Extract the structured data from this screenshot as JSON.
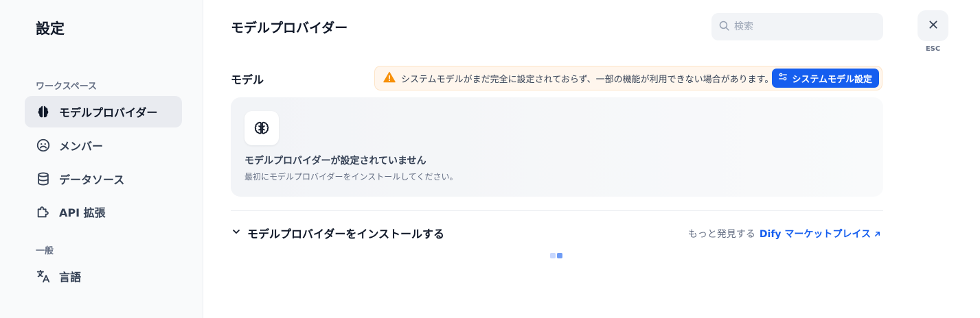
{
  "sidebar": {
    "title": "設定",
    "workspace_label": "ワークスペース",
    "general_label": "一般",
    "items": [
      {
        "label": "モデルプロバイダー",
        "icon": "brain-icon",
        "active": true
      },
      {
        "label": "メンバー",
        "icon": "members-icon",
        "active": false
      },
      {
        "label": "データソース",
        "icon": "database-icon",
        "active": false
      },
      {
        "label": "API 拡張",
        "icon": "puzzle-icon",
        "active": false
      },
      {
        "label": "言語",
        "icon": "translate-icon",
        "active": false
      }
    ]
  },
  "header": {
    "title": "モデルプロバイダー",
    "search_placeholder": "検索",
    "close_label": "ESC"
  },
  "model_section": {
    "label": "モデル",
    "warning_text": "システムモデルがまだ完全に設定されておらず、一部の機能が利用できない場合があります。",
    "system_button_label": "システムモデル設定"
  },
  "empty_state": {
    "title": "モデルプロバイダーが設定されていません",
    "description": "最初にモデルプロバイダーをインストールしてください。"
  },
  "install_section": {
    "toggle_label": "モデルプロバイダーをインストールする",
    "discover_text": "もっと発見する",
    "marketplace_link": "Dify マーケットプレイス"
  },
  "colors": {
    "accent": "#155eef",
    "warning": "#f79009",
    "sidebar_bg": "#f9fafb"
  }
}
